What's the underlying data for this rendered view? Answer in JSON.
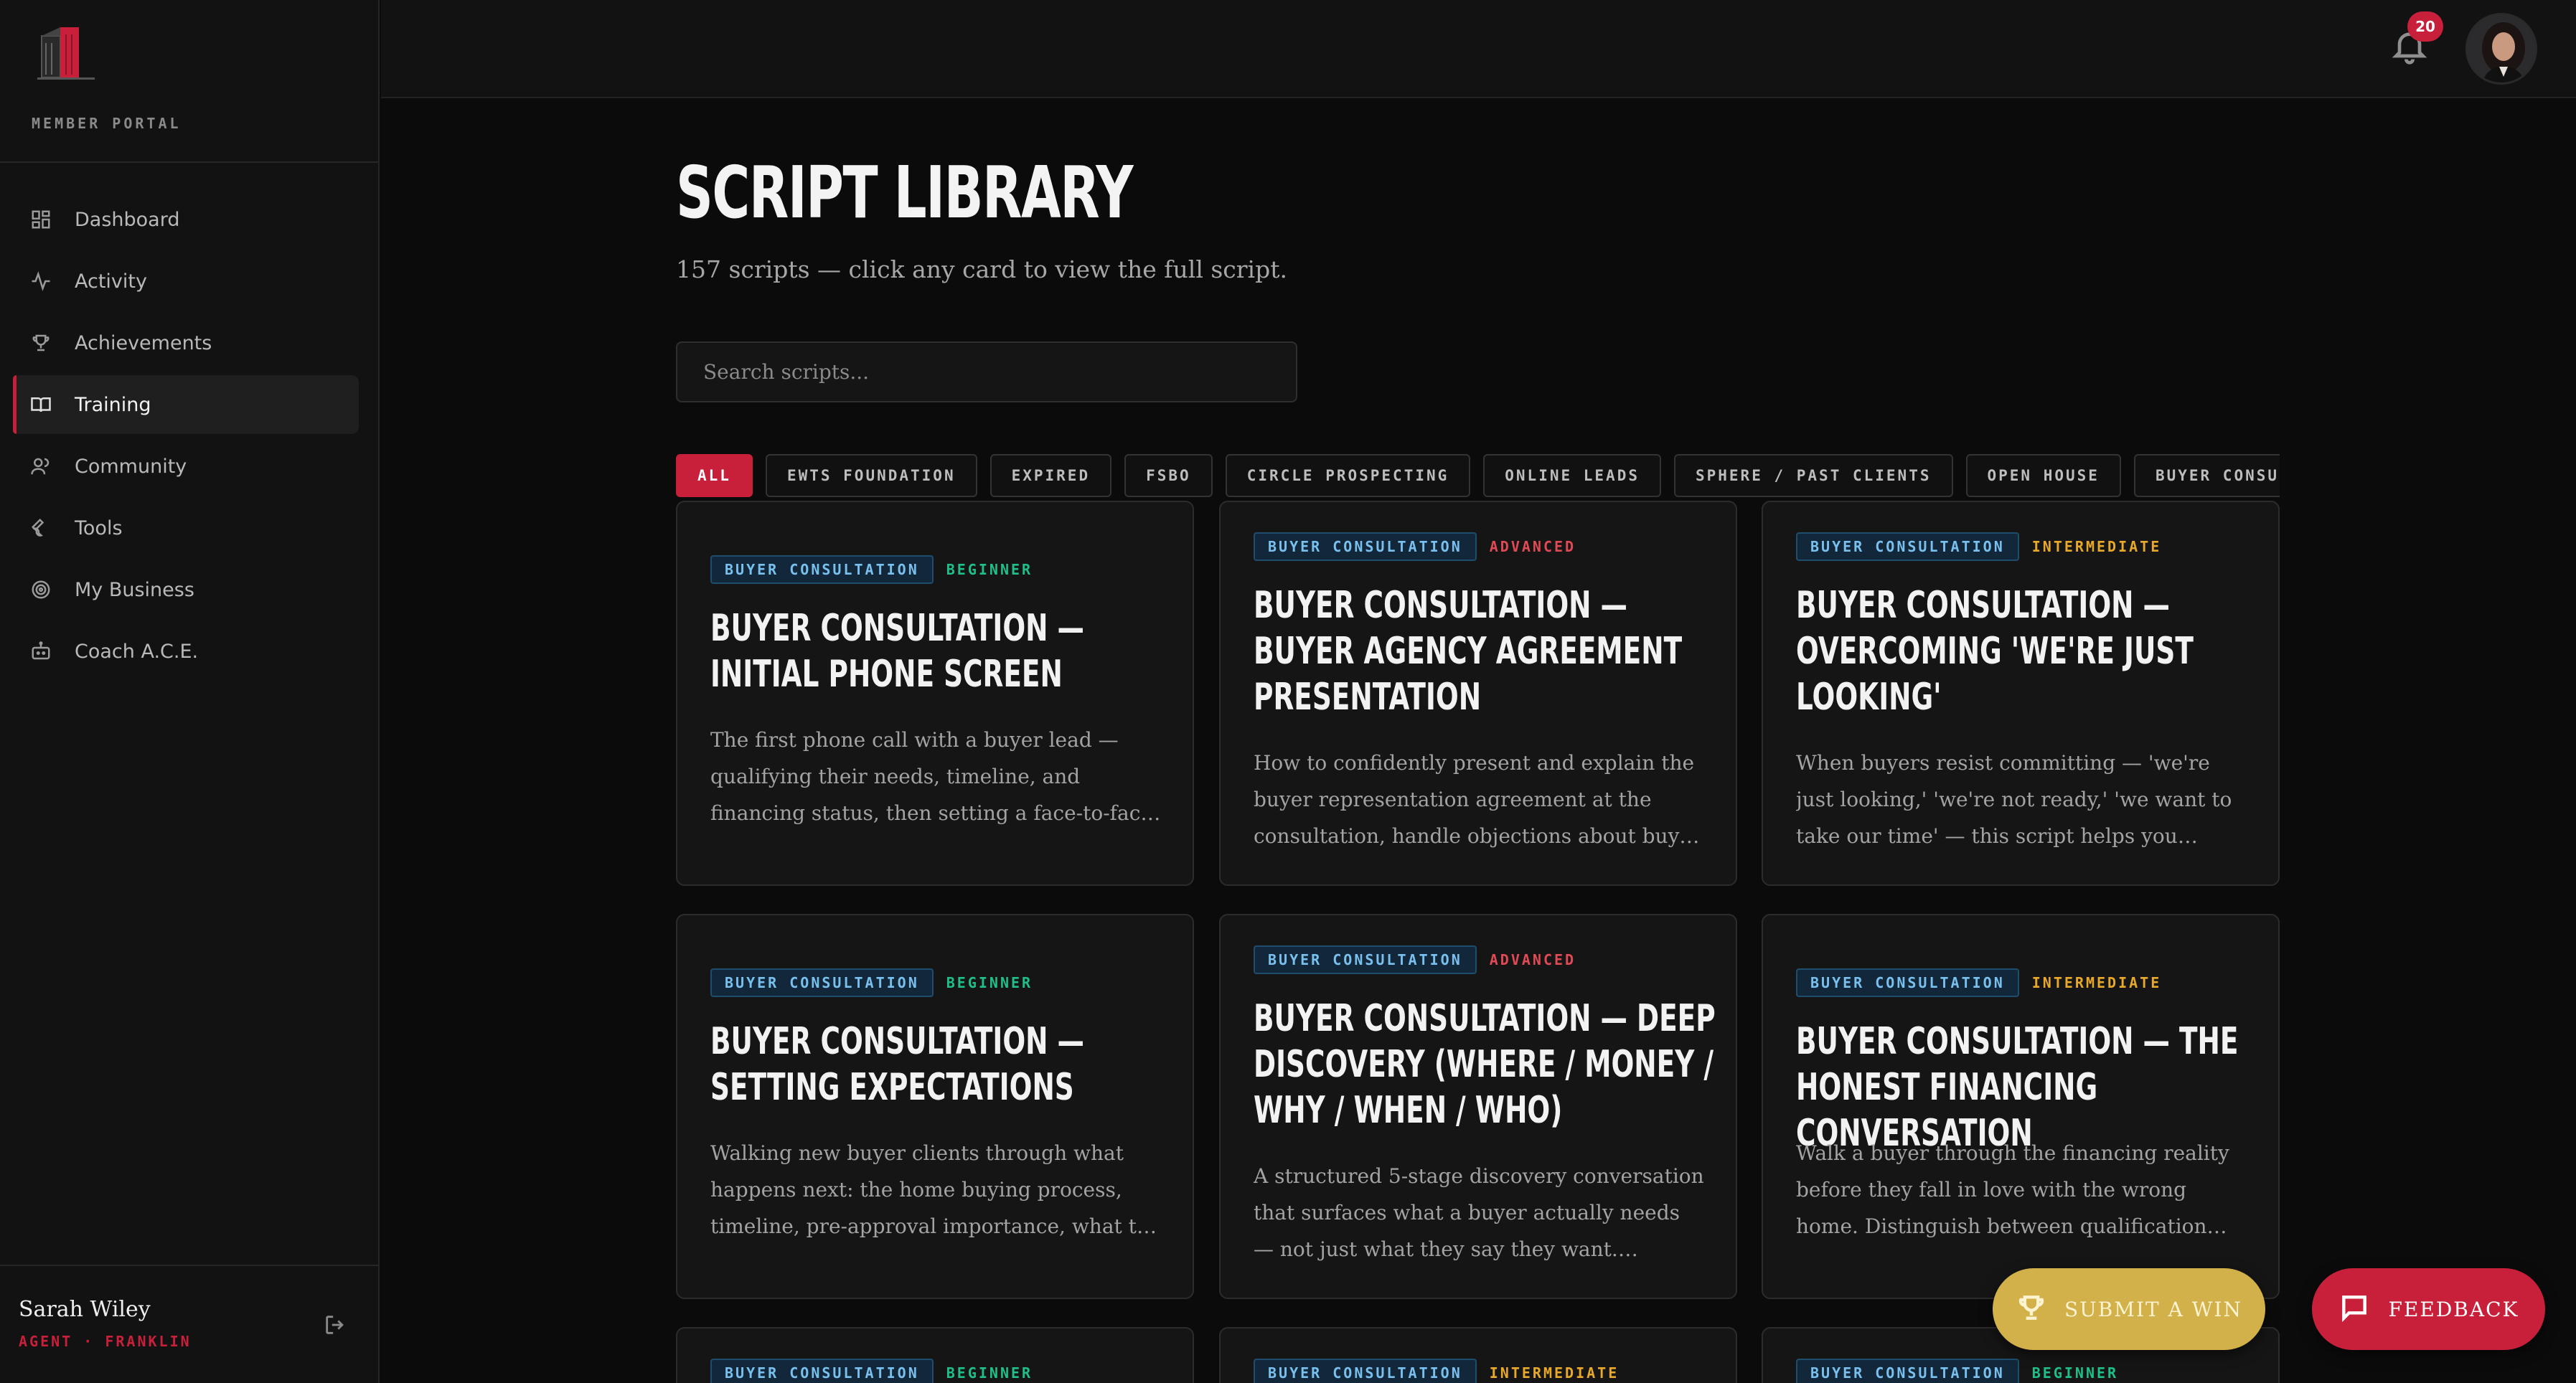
{
  "sidebar": {
    "portal_label": "MEMBER PORTAL",
    "items": [
      {
        "label": "Dashboard",
        "icon": "grid-icon"
      },
      {
        "label": "Activity",
        "icon": "activity-icon"
      },
      {
        "label": "Achievements",
        "icon": "trophy-icon"
      },
      {
        "label": "Training",
        "icon": "book-icon",
        "active": true
      },
      {
        "label": "Community",
        "icon": "users-icon"
      },
      {
        "label": "Tools",
        "icon": "wrench-icon"
      },
      {
        "label": "My Business",
        "icon": "target-icon"
      },
      {
        "label": "Coach A.C.E.",
        "icon": "bot-icon"
      }
    ],
    "user": {
      "name": "Sarah Wiley",
      "role": "AGENT · FRANKLIN"
    }
  },
  "topbar": {
    "notification_count": "20"
  },
  "main": {
    "title": "SCRIPT LIBRARY",
    "subtitle": "157 scripts — click any card to view the full script.",
    "search_placeholder": "Search scripts...",
    "filters": [
      "ALL",
      "EWTS FOUNDATION",
      "EXPIRED",
      "FSBO",
      "CIRCLE PROSPECTING",
      "ONLINE LEADS",
      "SPHERE / PAST CLIENTS",
      "OPEN HOUSE",
      "BUYER CONSULTATION",
      ""
    ],
    "cards": [
      {
        "category": "BUYER CONSULTATION",
        "level": "BEGINNER",
        "title": "BUYER CONSULTATION — INITIAL PHONE SCREEN",
        "description": "The first phone call with a buyer lead — qualifying their needs, timeline, and financing status, then setting a face-to-face consultation..."
      },
      {
        "category": "BUYER CONSULTATION",
        "level": "ADVANCED",
        "title": "BUYER CONSULTATION — BUYER AGENCY AGREEMENT PRESENTATION",
        "description": "How to confidently present and explain the buyer representation agreement at the consultation, handle objections about buyer agent..."
      },
      {
        "category": "BUYER CONSULTATION",
        "level": "INTERMEDIATE",
        "title": "BUYER CONSULTATION — OVERCOMING 'WE'RE JUST LOOKING'",
        "description": "When buyers resist committing — 'we're just looking,' 'we're not ready,' 'we want to take our time' — this script helps you uncover their real..."
      },
      {
        "category": "BUYER CONSULTATION",
        "level": "BEGINNER",
        "title": "BUYER CONSULTATION — SETTING EXPECTATIONS",
        "description": "Walking new buyer clients through what happens next: the home buying process, timeline, pre-approval importance, what to expect at showing..."
      },
      {
        "category": "BUYER CONSULTATION",
        "level": "ADVANCED",
        "title": "BUYER CONSULTATION — DEEP DISCOVERY (WHERE / MONEY / WHY / WHEN / WHO)",
        "description": "A structured 5-stage discovery conversation that surfaces what a buyer actually needs — not just what they say they want. Replaces generic intak..."
      },
      {
        "category": "BUYER CONSULTATION",
        "level": "INTERMEDIATE",
        "title": "BUYER CONSULTATION — THE HONEST FINANCING CONVERSATION",
        "description": "Walk a buyer through the financing reality before they fall in love with the wrong home. Distinguish between qualification ceiling and..."
      },
      {
        "category": "BUYER CONSULTATION",
        "level": "BEGINNER",
        "title": "",
        "description": ""
      },
      {
        "category": "BUYER CONSULTATION",
        "level": "INTERMEDIATE",
        "title": "",
        "description": ""
      },
      {
        "category": "BUYER CONSULTATION",
        "level": "BEGINNER",
        "title": "",
        "description": ""
      }
    ]
  },
  "actions": {
    "submit_win": "SUBMIT A WIN",
    "feedback": "FEEDBACK"
  },
  "colors": {
    "accent": "#c8203a",
    "gold": "#d2b04a",
    "beginner": "#1fbf8a",
    "advanced": "#e04a55",
    "intermediate": "#e8a92a",
    "category_badge": "#79c0ee"
  }
}
